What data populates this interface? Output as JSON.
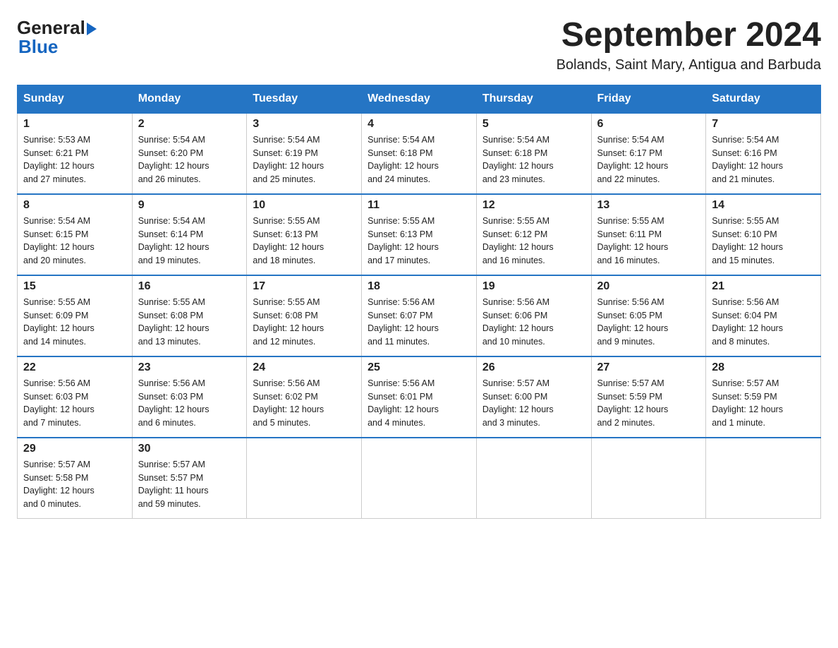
{
  "logo": {
    "general": "General",
    "blue": "Blue"
  },
  "title": {
    "month_year": "September 2024",
    "location": "Bolands, Saint Mary, Antigua and Barbuda"
  },
  "weekdays": [
    "Sunday",
    "Monday",
    "Tuesday",
    "Wednesday",
    "Thursday",
    "Friday",
    "Saturday"
  ],
  "weeks": [
    [
      {
        "day": "1",
        "sunrise": "5:53 AM",
        "sunset": "6:21 PM",
        "daylight": "12 hours and 27 minutes."
      },
      {
        "day": "2",
        "sunrise": "5:54 AM",
        "sunset": "6:20 PM",
        "daylight": "12 hours and 26 minutes."
      },
      {
        "day": "3",
        "sunrise": "5:54 AM",
        "sunset": "6:19 PM",
        "daylight": "12 hours and 25 minutes."
      },
      {
        "day": "4",
        "sunrise": "5:54 AM",
        "sunset": "6:18 PM",
        "daylight": "12 hours and 24 minutes."
      },
      {
        "day": "5",
        "sunrise": "5:54 AM",
        "sunset": "6:18 PM",
        "daylight": "12 hours and 23 minutes."
      },
      {
        "day": "6",
        "sunrise": "5:54 AM",
        "sunset": "6:17 PM",
        "daylight": "12 hours and 22 minutes."
      },
      {
        "day": "7",
        "sunrise": "5:54 AM",
        "sunset": "6:16 PM",
        "daylight": "12 hours and 21 minutes."
      }
    ],
    [
      {
        "day": "8",
        "sunrise": "5:54 AM",
        "sunset": "6:15 PM",
        "daylight": "12 hours and 20 minutes."
      },
      {
        "day": "9",
        "sunrise": "5:54 AM",
        "sunset": "6:14 PM",
        "daylight": "12 hours and 19 minutes."
      },
      {
        "day": "10",
        "sunrise": "5:55 AM",
        "sunset": "6:13 PM",
        "daylight": "12 hours and 18 minutes."
      },
      {
        "day": "11",
        "sunrise": "5:55 AM",
        "sunset": "6:13 PM",
        "daylight": "12 hours and 17 minutes."
      },
      {
        "day": "12",
        "sunrise": "5:55 AM",
        "sunset": "6:12 PM",
        "daylight": "12 hours and 16 minutes."
      },
      {
        "day": "13",
        "sunrise": "5:55 AM",
        "sunset": "6:11 PM",
        "daylight": "12 hours and 16 minutes."
      },
      {
        "day": "14",
        "sunrise": "5:55 AM",
        "sunset": "6:10 PM",
        "daylight": "12 hours and 15 minutes."
      }
    ],
    [
      {
        "day": "15",
        "sunrise": "5:55 AM",
        "sunset": "6:09 PM",
        "daylight": "12 hours and 14 minutes."
      },
      {
        "day": "16",
        "sunrise": "5:55 AM",
        "sunset": "6:08 PM",
        "daylight": "12 hours and 13 minutes."
      },
      {
        "day": "17",
        "sunrise": "5:55 AM",
        "sunset": "6:08 PM",
        "daylight": "12 hours and 12 minutes."
      },
      {
        "day": "18",
        "sunrise": "5:56 AM",
        "sunset": "6:07 PM",
        "daylight": "12 hours and 11 minutes."
      },
      {
        "day": "19",
        "sunrise": "5:56 AM",
        "sunset": "6:06 PM",
        "daylight": "12 hours and 10 minutes."
      },
      {
        "day": "20",
        "sunrise": "5:56 AM",
        "sunset": "6:05 PM",
        "daylight": "12 hours and 9 minutes."
      },
      {
        "day": "21",
        "sunrise": "5:56 AM",
        "sunset": "6:04 PM",
        "daylight": "12 hours and 8 minutes."
      }
    ],
    [
      {
        "day": "22",
        "sunrise": "5:56 AM",
        "sunset": "6:03 PM",
        "daylight": "12 hours and 7 minutes."
      },
      {
        "day": "23",
        "sunrise": "5:56 AM",
        "sunset": "6:03 PM",
        "daylight": "12 hours and 6 minutes."
      },
      {
        "day": "24",
        "sunrise": "5:56 AM",
        "sunset": "6:02 PM",
        "daylight": "12 hours and 5 minutes."
      },
      {
        "day": "25",
        "sunrise": "5:56 AM",
        "sunset": "6:01 PM",
        "daylight": "12 hours and 4 minutes."
      },
      {
        "day": "26",
        "sunrise": "5:57 AM",
        "sunset": "6:00 PM",
        "daylight": "12 hours and 3 minutes."
      },
      {
        "day": "27",
        "sunrise": "5:57 AM",
        "sunset": "5:59 PM",
        "daylight": "12 hours and 2 minutes."
      },
      {
        "day": "28",
        "sunrise": "5:57 AM",
        "sunset": "5:59 PM",
        "daylight": "12 hours and 1 minute."
      }
    ],
    [
      {
        "day": "29",
        "sunrise": "5:57 AM",
        "sunset": "5:58 PM",
        "daylight": "12 hours and 0 minutes."
      },
      {
        "day": "30",
        "sunrise": "5:57 AM",
        "sunset": "5:57 PM",
        "daylight": "11 hours and 59 minutes."
      },
      null,
      null,
      null,
      null,
      null
    ]
  ],
  "labels": {
    "sunrise": "Sunrise:",
    "sunset": "Sunset:",
    "daylight": "Daylight:"
  }
}
